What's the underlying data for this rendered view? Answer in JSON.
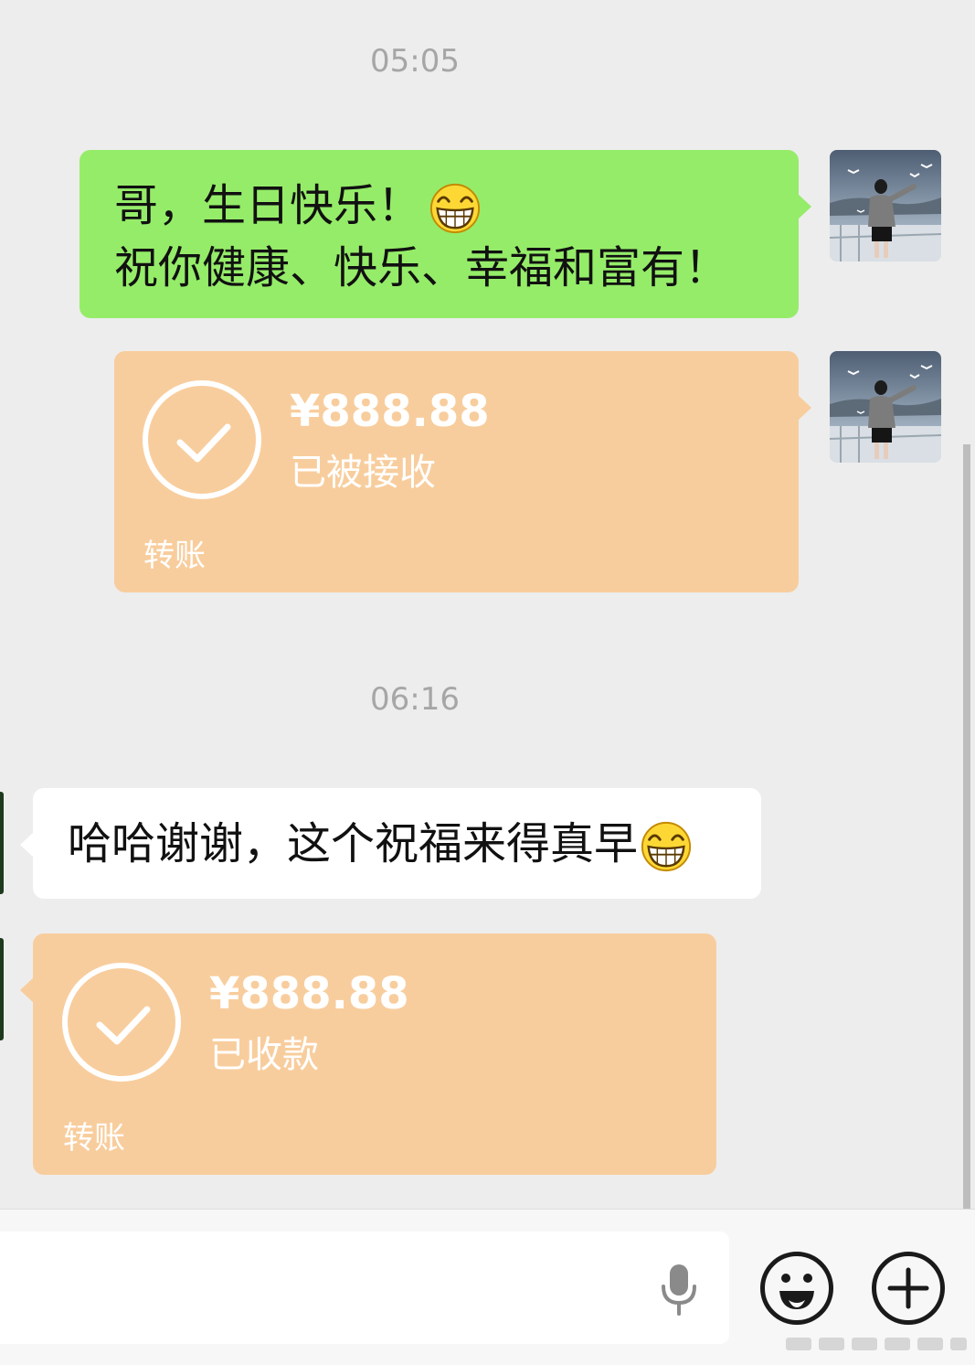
{
  "messages": {
    "time_1": "05:05",
    "greeting": {
      "line_1": "哥，生日快乐！",
      "line_2": "祝你健康、快乐、幸福和富有！",
      "emoji": "grinning-face-emoji"
    },
    "transfer_sent": {
      "amount": "¥888.88",
      "status": "已被接收",
      "kind": "转账"
    },
    "time_2": "06:16",
    "reply": {
      "text": "哈哈谢谢，这个祝福来得真早",
      "emoji": "grinning-face-emoji"
    },
    "transfer_received": {
      "amount": "¥888.88",
      "status": "已收款",
      "kind": "转账"
    }
  },
  "input_bar": {
    "text": "",
    "voice_icon": "microphone-icon",
    "emoji_icon": "smiley-icon",
    "more_icon": "plus-icon"
  },
  "colors": {
    "chat_background": "#ededed",
    "outgoing_bubble": "#95ec69",
    "incoming_bubble": "#ffffff",
    "transfer_bubble": "#f8cd9d",
    "timestamp_text": "#a6a6a6"
  }
}
